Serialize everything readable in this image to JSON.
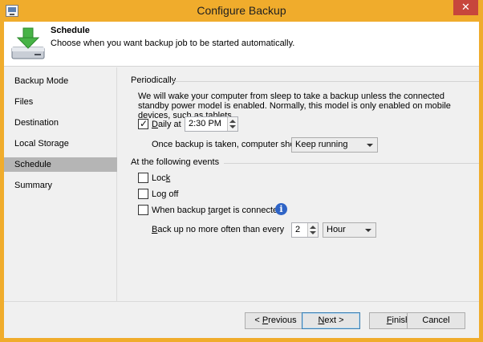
{
  "window": {
    "title": "Configure Backup",
    "close_glyph": "✕"
  },
  "header": {
    "title": "Schedule",
    "description": "Choose when you want backup job to be started automatically.",
    "icon": "backup-drive-download-icon"
  },
  "sidebar": {
    "items": [
      {
        "label": "Backup Mode",
        "selected": false
      },
      {
        "label": "Files",
        "selected": false
      },
      {
        "label": "Destination",
        "selected": false
      },
      {
        "label": "Local Storage",
        "selected": false
      },
      {
        "label": "Schedule",
        "selected": true
      },
      {
        "label": "Summary",
        "selected": false
      }
    ]
  },
  "periodically": {
    "label": "Periodically",
    "info": "We will wake your computer from sleep to take a backup unless the connected standby power model is enabled. Normally, this model is only enabled on mobile devices, such as tablets.",
    "daily": {
      "label_prefix": "D",
      "label_rest": "aily at",
      "checked": true,
      "time": "2:30 PM"
    },
    "after_backup": {
      "label": "Once backup is taken, computer should",
      "value": "Keep running"
    }
  },
  "events": {
    "label": "At the following events",
    "lock": {
      "label_pre": "Loc",
      "label_u": "k",
      "label_post": "",
      "checked": false
    },
    "logoff": {
      "label_pre": "Lo",
      "label_u": "g",
      "label_post": " off",
      "checked": false
    },
    "target": {
      "label_pre": "When backup ",
      "label_u": "t",
      "label_post": "arget is connected",
      "checked": false
    },
    "no_more": {
      "label_pre": "",
      "label_u": "B",
      "label_post": "ack up no more often than every",
      "value": "2",
      "unit": "Hour"
    }
  },
  "footer": {
    "previous": {
      "pre": "< ",
      "u": "P",
      "post": "revious"
    },
    "next": {
      "pre": "",
      "u": "N",
      "post": "ext >"
    },
    "finish": {
      "pre": "",
      "u": "F",
      "post": "inish"
    },
    "cancel": "Cancel"
  }
}
